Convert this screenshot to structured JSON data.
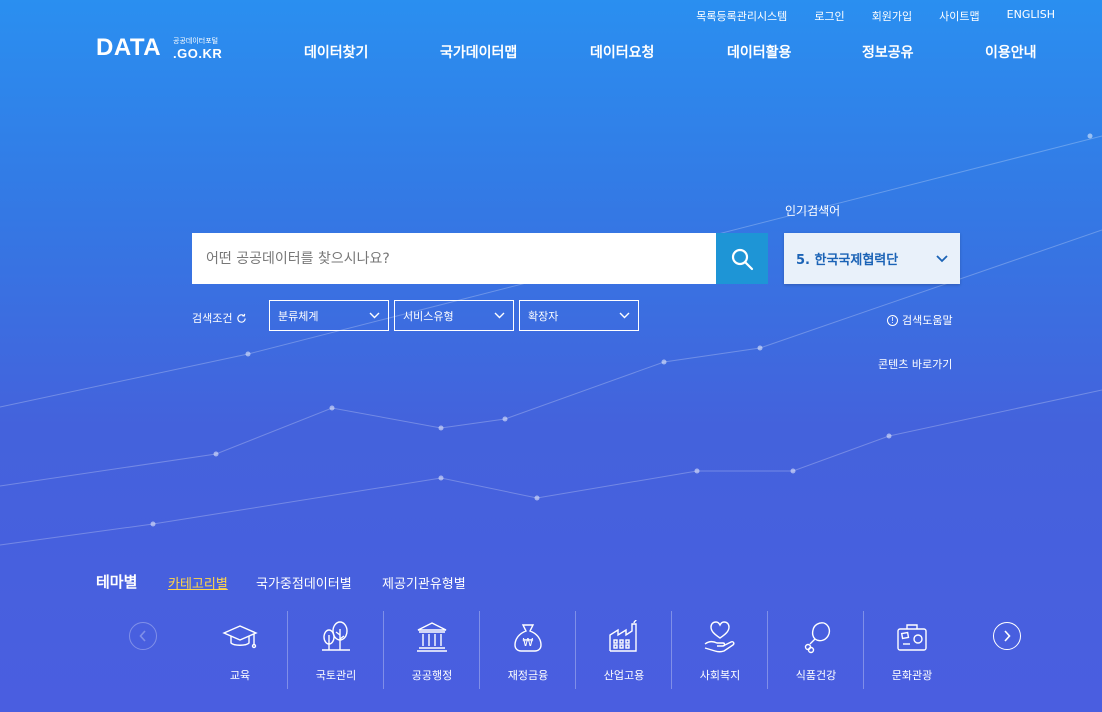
{
  "top_util": [
    "목록등록관리시스템",
    "로그인",
    "회원가입",
    "사이트맵",
    "ENGLISH"
  ],
  "logo": {
    "main": "DATA",
    "small": "공공데이터포털",
    "sub": ".GO.KR"
  },
  "gnb": [
    "데이터찾기",
    "국가데이터맵",
    "데이터요청",
    "데이터활용",
    "정보공유",
    "이용안내"
  ],
  "search": {
    "placeholder": "어떤 공공데이터를 찾으시나요?"
  },
  "hot": {
    "label": "인기검색어",
    "current": "5. 한국국제협력단"
  },
  "conditions": {
    "label": "검색조건",
    "selects": [
      "분류체계",
      "서비스유형",
      "확장자"
    ]
  },
  "help": "검색도움말",
  "shortcut": "콘텐츠 바로가기",
  "theme": {
    "title": "테마별",
    "tabs": [
      "카테고리별",
      "국가중점데이터별",
      "제공기관유형별"
    ]
  },
  "categories": [
    {
      "label": "교육",
      "icon": "graduation-cap-icon"
    },
    {
      "label": "국토관리",
      "icon": "trees-icon"
    },
    {
      "label": "공공행정",
      "icon": "government-building-icon"
    },
    {
      "label": "재정금융",
      "icon": "money-bag-icon"
    },
    {
      "label": "산업고용",
      "icon": "factory-icon"
    },
    {
      "label": "사회복지",
      "icon": "heart-hand-icon"
    },
    {
      "label": "식품건강",
      "icon": "chicken-leg-icon"
    },
    {
      "label": "문화관광",
      "icon": "suitcase-icon"
    }
  ],
  "colors": {
    "search_button": "#1e95d6",
    "hot_text": "#1b63b6",
    "active_tab": "#ffd54a"
  }
}
